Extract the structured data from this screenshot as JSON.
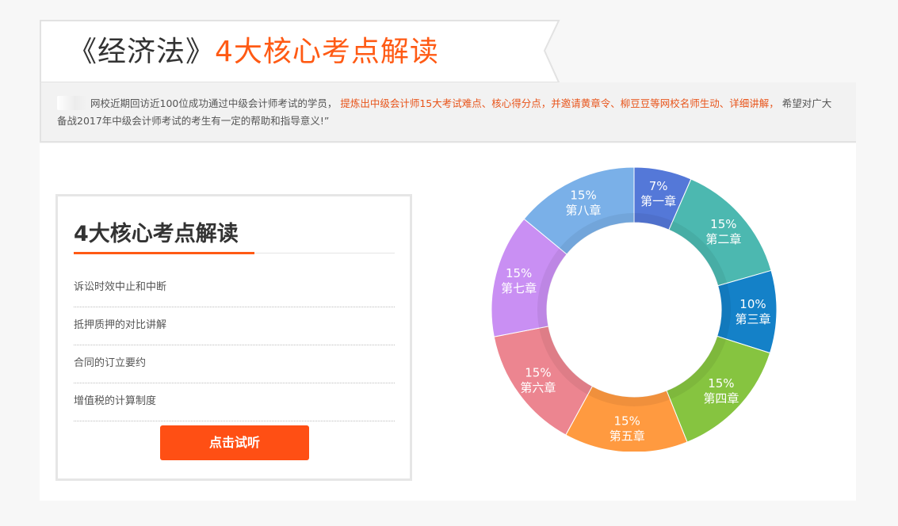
{
  "banner": {
    "title_black": "《经济法》",
    "title_orange": "4大核心考点解读"
  },
  "intro": {
    "part1": "网校近期回访近100位成功通过中级会计师考试的学员，",
    "highlight": "提炼出中级会计师15大考试难点、核心得分点，并邀请黄章令、柳豆豆等网校名师生动、详细讲解，",
    "part2": "希望对广大备战2017年中级会计师考试的考生有一定的帮助和指导意义!”"
  },
  "card": {
    "title": "4大核心考点解读",
    "topics": [
      "诉讼时效中止和中断",
      "抵押质押的对比讲解",
      "合同的订立要约",
      "增值税的计算制度"
    ],
    "button_label": "点击试听"
  },
  "chart_data": {
    "type": "pie",
    "donut": true,
    "slices": [
      {
        "label": "第一章",
        "value": 7,
        "display": "7%",
        "color": "#5478d8"
      },
      {
        "label": "第二章",
        "value": 15,
        "display": "15%",
        "color": "#4cb8b0"
      },
      {
        "label": "第三章",
        "value": 10,
        "display": "10%",
        "color": "#1481c8"
      },
      {
        "label": "第四章",
        "value": 15,
        "display": "15%",
        "color": "#86c440"
      },
      {
        "label": "第五章",
        "value": 15,
        "display": "15%",
        "color": "#ff9a40"
      },
      {
        "label": "第六章",
        "value": 15,
        "display": "15%",
        "color": "#ec8590"
      },
      {
        "label": "第七章",
        "value": 15,
        "display": "15%",
        "color": "#c98ff3"
      },
      {
        "label": "第八章",
        "value": 15,
        "display": "15%",
        "color": "#7ab0e8"
      }
    ]
  }
}
